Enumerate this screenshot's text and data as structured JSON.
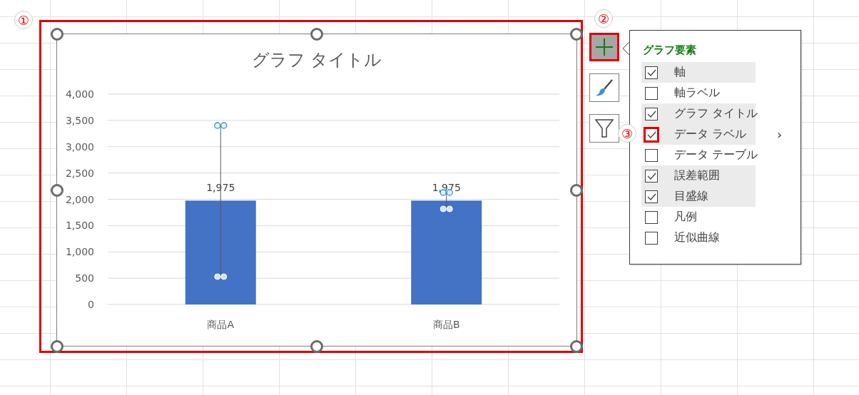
{
  "chart": {
    "selected": true,
    "marked": true,
    "callout": "①",
    "chart_data": {
      "type": "bar",
      "title": "グラフ タイトル",
      "categories": [
        "商品A",
        "商品B"
      ],
      "series": [
        {
          "color": "#4472c4",
          "values": [
            1975,
            1975
          ]
        }
      ],
      "grid": true,
      "ylim": [
        0,
        4000
      ],
      "yticks": [
        {
          "value": 0,
          "label": "0"
        },
        {
          "value": 500,
          "label": "500"
        },
        {
          "value": 1000,
          "label": "1,000"
        },
        {
          "value": 1500,
          "label": "1,500"
        },
        {
          "value": 2000,
          "label": "2,000"
        },
        {
          "value": 2500,
          "label": "2,500"
        },
        {
          "value": 3000,
          "label": "3,000"
        },
        {
          "value": 3500,
          "label": "3,500"
        },
        {
          "value": 4000,
          "label": "4,000"
        }
      ],
      "value_labels": [
        "1,975",
        "1,975"
      ]
    }
  },
  "tool_buttons": [
    {
      "kind": "elements",
      "selected": true,
      "marked": true,
      "callout": "②"
    },
    {
      "kind": "styles",
      "selected": false,
      "marked": false
    },
    {
      "kind": "filters",
      "selected": false,
      "marked": false
    }
  ],
  "elements_panel": {
    "title": "グラフ要素",
    "items": [
      {
        "label": "軸",
        "checked": true,
        "marked": false
      },
      {
        "label": "軸ラベル",
        "checked": false,
        "marked": false
      },
      {
        "label": "グラフ タイトル",
        "checked": true,
        "marked": false
      },
      {
        "label": "データ ラベル",
        "checked": true,
        "marked": true,
        "callout": "③",
        "submenu": "›"
      },
      {
        "label": "データ テーブル",
        "checked": false,
        "marked": false
      },
      {
        "label": "誤差範囲",
        "checked": true,
        "marked": false
      },
      {
        "label": "目盛線",
        "checked": true,
        "marked": false
      },
      {
        "label": "凡例",
        "checked": false,
        "marked": false
      },
      {
        "label": "近似曲線",
        "checked": false,
        "marked": false
      }
    ]
  }
}
